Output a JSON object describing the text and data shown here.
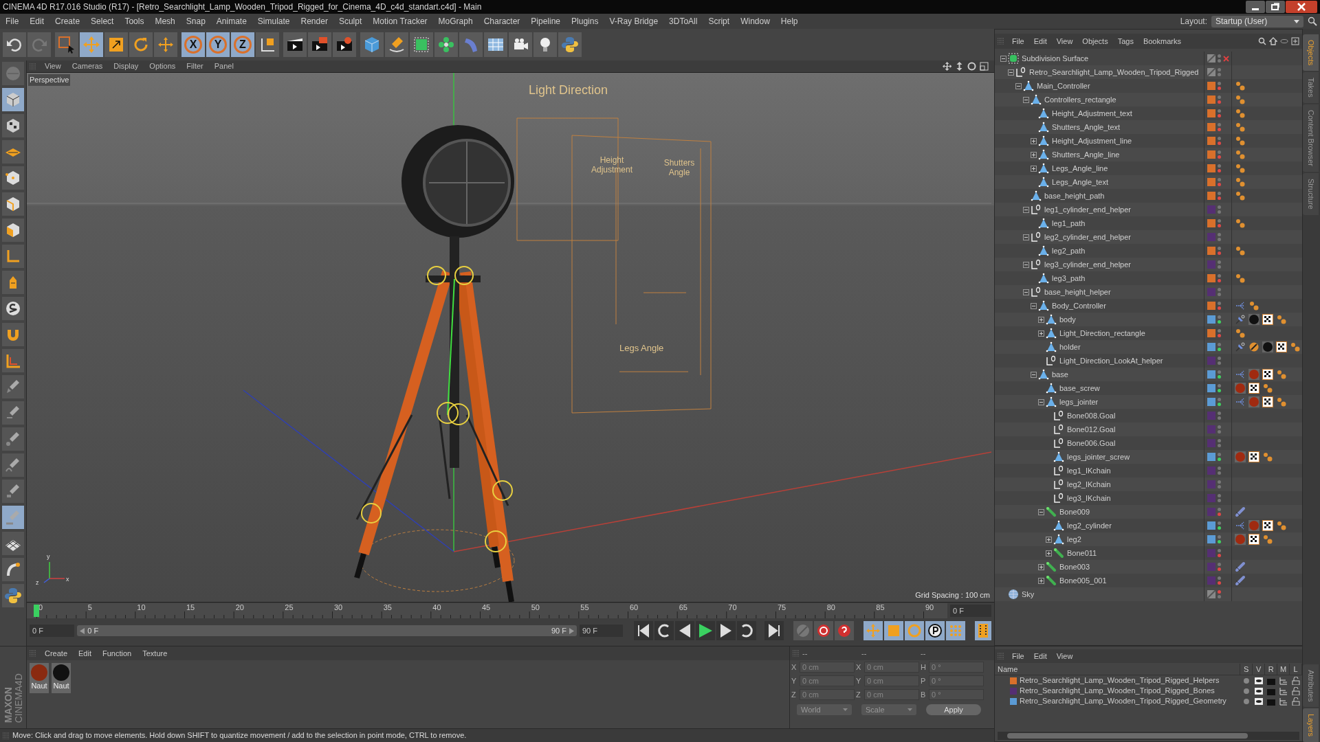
{
  "window": {
    "title": "CINEMA 4D R17.016 Studio (R17) - [Retro_Searchlight_Lamp_Wooden_Tripod_Rigged_for_Cinema_4D_c4d_standart.c4d] - Main"
  },
  "menu": [
    "File",
    "Edit",
    "Create",
    "Select",
    "Tools",
    "Mesh",
    "Snap",
    "Animate",
    "Simulate",
    "Render",
    "Sculpt",
    "Motion Tracker",
    "MoGraph",
    "Character",
    "Pipeline",
    "Plugins",
    "V-Ray Bridge",
    "3DToAll",
    "Script",
    "Window",
    "Help"
  ],
  "layout": {
    "label": "Layout:",
    "value": "Startup (User)"
  },
  "toolbar": {
    "mode_tools": [
      {
        "kind": "select",
        "selected": false
      },
      {
        "kind": "move",
        "selected": true
      },
      {
        "kind": "scale",
        "selected": false
      },
      {
        "kind": "rotate",
        "selected": false
      },
      {
        "kind": "last",
        "selected": false
      }
    ],
    "axes": [
      {
        "label": "X",
        "on": true
      },
      {
        "label": "Y",
        "on": true
      },
      {
        "label": "Z",
        "on": true
      }
    ]
  },
  "viewport": {
    "menu": [
      "View",
      "Cameras",
      "Display",
      "Options",
      "Filter",
      "Panel"
    ],
    "camera": "Perspective",
    "labels": [
      {
        "kind": "title",
        "text": "Light Direction"
      },
      {
        "kind": "height",
        "text": "Height Adjustment"
      },
      {
        "kind": "shutters",
        "text": "Shutters Angle"
      },
      {
        "kind": "legs",
        "text": "Legs Angle"
      }
    ],
    "axis_labels": [
      "y",
      "z",
      "x"
    ],
    "grid_spacing": "Grid Spacing : 100 cm"
  },
  "timeline": {
    "ticks": [
      "0",
      "5",
      "10",
      "15",
      "20",
      "25",
      "30",
      "35",
      "40",
      "45",
      "50",
      "55",
      "60",
      "65",
      "70",
      "75",
      "80",
      "85",
      "90"
    ],
    "level": 0,
    "current_frame": "0 F",
    "start_field": "0 F",
    "range": {
      "start": "0 F",
      "end": "90 F"
    },
    "end_field": "90 F"
  },
  "materials": {
    "menu": [
      "Create",
      "Edit",
      "Function",
      "Texture"
    ],
    "items": [
      {
        "name": "Naut",
        "color": "#8a2a10"
      },
      {
        "name": "Naut",
        "color": "#111111"
      }
    ]
  },
  "logo": [
    "MAXON",
    "CINEMA4D"
  ],
  "coordinates": {
    "disabled": true,
    "headers": [
      "--",
      "--",
      "--"
    ],
    "rows": [
      {
        "axis": "X",
        "value": "0 cm",
        "size_axis": "X",
        "size": "0 cm",
        "rot_axis": "H",
        "rot": "0 °"
      },
      {
        "axis": "Y",
        "value": "0 cm",
        "size_axis": "Y",
        "size": "0 cm",
        "rot_axis": "P",
        "rot": "0 °"
      },
      {
        "axis": "Z",
        "value": "0 cm",
        "size_axis": "Z",
        "size": "0 cm",
        "rot_axis": "B",
        "rot": "0 °"
      }
    ],
    "space": "World",
    "mode": "Scale",
    "apply": "Apply"
  },
  "status_bar": "Move: Click and drag to move elements. Hold down SHIFT to quantize movement / add to the selection in point mode, CTRL to remove.",
  "objects": {
    "menu": [
      "File",
      "Edit",
      "View",
      "Objects",
      "Tags",
      "Bookmarks"
    ],
    "tree": [
      {
        "name": "Subdivision Surface",
        "kind": "generator",
        "expanded": true,
        "enabled": false,
        "children": [
          {
            "name": "Retro_Searchlight_Lamp_Wooden_Tripod_Rigged",
            "kind": "null",
            "expanded": true,
            "children": [
              {
                "name": "Main_Controller",
                "kind": "polygon",
                "color": "#d9702b",
                "expanded": true,
                "render_visible": false,
                "tags": [
                  {
                    "kind": "display"
                  }
                ],
                "children": [
                  {
                    "name": "Controllers_rectangle",
                    "kind": "polygon",
                    "color": "#d9702b",
                    "expanded": true,
                    "render_visible": false,
                    "tags": [
                      {
                        "kind": "display"
                      }
                    ],
                    "children": [
                      {
                        "name": "Height_Adjustment_text",
                        "kind": "polygon",
                        "color": "#d9702b",
                        "render_visible": false,
                        "tags": [
                          {
                            "kind": "display"
                          }
                        ]
                      },
                      {
                        "name": "Shutters_Angle_text",
                        "kind": "polygon",
                        "color": "#d9702b",
                        "render_visible": false,
                        "tags": [
                          {
                            "kind": "display"
                          }
                        ]
                      },
                      {
                        "name": "Height_Adjustment_line",
                        "kind": "polygon",
                        "color": "#d9702b",
                        "expanded": false,
                        "render_visible": false,
                        "tags": [
                          {
                            "kind": "display"
                          }
                        ]
                      },
                      {
                        "name": "Shutters_Angle_line",
                        "kind": "polygon",
                        "color": "#d9702b",
                        "expanded": false,
                        "render_visible": false,
                        "tags": [
                          {
                            "kind": "display"
                          }
                        ]
                      },
                      {
                        "name": "Legs_Angle_line",
                        "kind": "polygon",
                        "color": "#d9702b",
                        "expanded": false,
                        "render_visible": false,
                        "tags": [
                          {
                            "kind": "display"
                          }
                        ]
                      },
                      {
                        "name": "Legs_Angle_text",
                        "kind": "polygon",
                        "color": "#d9702b",
                        "render_visible": false,
                        "tags": [
                          {
                            "kind": "display"
                          }
                        ]
                      }
                    ]
                  },
                  {
                    "name": "base_height_path",
                    "kind": "polygon",
                    "color": "#d9702b",
                    "render_visible": false,
                    "tags": [
                      {
                        "kind": "display"
                      }
                    ]
                  },
                  {
                    "name": "leg1_cylinder_end_helper",
                    "kind": "null",
                    "color": "#552f73",
                    "expanded": true,
                    "children": [
                      {
                        "name": "leg1_path",
                        "kind": "polygon",
                        "color": "#d9702b",
                        "render_visible": false,
                        "tags": [
                          {
                            "kind": "display"
                          }
                        ]
                      }
                    ]
                  },
                  {
                    "name": "leg2_cylinder_end_helper",
                    "kind": "null",
                    "color": "#552f73",
                    "expanded": true,
                    "children": [
                      {
                        "name": "leg2_path",
                        "kind": "polygon",
                        "color": "#d9702b",
                        "render_visible": false,
                        "tags": [
                          {
                            "kind": "display"
                          }
                        ]
                      }
                    ]
                  },
                  {
                    "name": "leg3_cylinder_end_helper",
                    "kind": "null",
                    "color": "#552f73",
                    "expanded": true,
                    "children": [
                      {
                        "name": "leg3_path",
                        "kind": "polygon",
                        "color": "#d9702b",
                        "render_visible": false,
                        "tags": [
                          {
                            "kind": "display"
                          }
                        ]
                      }
                    ]
                  },
                  {
                    "name": "base_height_helper",
                    "kind": "null",
                    "color": "#552f73",
                    "expanded": true,
                    "children": [
                      {
                        "name": "Body_Controller",
                        "kind": "polygon",
                        "color": "#d9702b",
                        "expanded": true,
                        "render_visible": false,
                        "tags": [
                          {
                            "kind": "constraint"
                          },
                          {
                            "kind": "display"
                          }
                        ],
                        "children": [
                          {
                            "name": "body",
                            "kind": "polygon",
                            "color": "#5b9bd5",
                            "expanded": false,
                            "render_visible": true,
                            "tags": [
                              {
                                "kind": "pin"
                              },
                              {
                                "kind": "black"
                              },
                              {
                                "kind": "texture"
                              },
                              {
                                "kind": "display"
                              }
                            ]
                          },
                          {
                            "name": "Light_Direction_rectangle",
                            "kind": "polygon",
                            "color": "#d9702b",
                            "expanded": false,
                            "render_visible": false,
                            "tags": [
                              {
                                "kind": "display"
                              }
                            ]
                          },
                          {
                            "name": "holder",
                            "kind": "polygon",
                            "color": "#5b9bd5",
                            "render_visible": true,
                            "tags": [
                              {
                                "kind": "pin"
                              },
                              {
                                "kind": "prohibit"
                              },
                              {
                                "kind": "black"
                              },
                              {
                                "kind": "texture"
                              },
                              {
                                "kind": "display"
                              }
                            ]
                          },
                          {
                            "name": "Light_Direction_LookAt_helper",
                            "kind": "null",
                            "color": "#552f73"
                          }
                        ]
                      },
                      {
                        "name": "base",
                        "kind": "polygon",
                        "color": "#5b9bd5",
                        "expanded": true,
                        "render_visible": true,
                        "tags": [
                          {
                            "kind": "constraint"
                          },
                          {
                            "kind": "red"
                          },
                          {
                            "kind": "texture"
                          },
                          {
                            "kind": "display"
                          }
                        ],
                        "children": [
                          {
                            "name": "base_screw",
                            "kind": "polygon",
                            "color": "#5b9bd5",
                            "render_visible": true,
                            "tags": [
                              {
                                "kind": "red"
                              },
                              {
                                "kind": "texture"
                              },
                              {
                                "kind": "display"
                              }
                            ]
                          },
                          {
                            "name": "legs_jointer",
                            "kind": "polygon",
                            "color": "#5b9bd5",
                            "expanded": true,
                            "render_visible": true,
                            "tags": [
                              {
                                "kind": "constraint"
                              },
                              {
                                "kind": "red"
                              },
                              {
                                "kind": "texture"
                              },
                              {
                                "kind": "display"
                              }
                            ],
                            "children": [
                              {
                                "name": "Bone008.Goal",
                                "kind": "null",
                                "color": "#552f73"
                              },
                              {
                                "name": "Bone012.Goal",
                                "kind": "null",
                                "color": "#552f73"
                              },
                              {
                                "name": "Bone006.Goal",
                                "kind": "null",
                                "color": "#552f73"
                              },
                              {
                                "name": "legs_jointer_screw",
                                "kind": "polygon",
                                "color": "#5b9bd5",
                                "render_visible": true,
                                "tags": [
                                  {
                                    "kind": "red"
                                  },
                                  {
                                    "kind": "texture"
                                  },
                                  {
                                    "kind": "display"
                                  }
                                ]
                              },
                              {
                                "name": "leg1_IKchain",
                                "kind": "null",
                                "color": "#552f73"
                              },
                              {
                                "name": "leg2_IKchain",
                                "kind": "null",
                                "color": "#552f73"
                              },
                              {
                                "name": "leg3_IKchain",
                                "kind": "null",
                                "color": "#552f73"
                              }
                            ]
                          },
                          {
                            "name": "Bone009",
                            "kind": "bone",
                            "color": "#552f73",
                            "expanded": true,
                            "render_visible": false,
                            "tags": [
                              {
                                "kind": "ik"
                              }
                            ],
                            "children": [
                              {
                                "name": "leg2_cylinder",
                                "kind": "polygon",
                                "color": "#5b9bd5",
                                "render_visible": true,
                                "tags": [
                                  {
                                    "kind": "constraint"
                                  },
                                  {
                                    "kind": "red"
                                  },
                                  {
                                    "kind": "texture"
                                  },
                                  {
                                    "kind": "display"
                                  }
                                ]
                              },
                              {
                                "name": "leg2",
                                "kind": "polygon",
                                "color": "#5b9bd5",
                                "expanded": false,
                                "render_visible": true,
                                "tags": [
                                  {
                                    "kind": "red"
                                  },
                                  {
                                    "kind": "texture"
                                  },
                                  {
                                    "kind": "display"
                                  }
                                ]
                              },
                              {
                                "name": "Bone011",
                                "kind": "bone",
                                "color": "#552f73",
                                "expanded": false,
                                "render_visible": false
                              }
                            ]
                          },
                          {
                            "name": "Bone003",
                            "kind": "bone",
                            "color": "#552f73",
                            "expanded": false,
                            "render_visible": false,
                            "tags": [
                              {
                                "kind": "ik"
                              }
                            ]
                          },
                          {
                            "name": "Bone005_001",
                            "kind": "bone",
                            "color": "#552f73",
                            "expanded": false,
                            "render_visible": false,
                            "tags": [
                              {
                                "kind": "ik"
                              }
                            ]
                          }
                        ]
                      }
                    ]
                  }
                ]
              }
            ]
          }
        ]
      },
      {
        "name": "Sky",
        "kind": "sky",
        "editor_visible": false
      }
    ]
  },
  "layers": {
    "menu": [
      "File",
      "Edit",
      "View"
    ],
    "columns": [
      "Name",
      "S",
      "V",
      "R",
      "M",
      "L"
    ],
    "rows": [
      {
        "name": "Retro_Searchlight_Lamp_Wooden_Tripod_Rigged_Helpers",
        "color": "#d9702b"
      },
      {
        "name": "Retro_Searchlight_Lamp_Wooden_Tripod_Rigged_Bones",
        "color": "#552f73"
      },
      {
        "name": "Retro_Searchlight_Lamp_Wooden_Tripod_Rigged_Geometry",
        "color": "#5b9bd5"
      }
    ]
  },
  "side_tabs_top": [
    {
      "label": "Objects",
      "selected": true
    },
    {
      "label": "Takes",
      "selected": false
    },
    {
      "label": "Content Browser",
      "selected": false
    },
    {
      "label": "Structure",
      "selected": false
    }
  ],
  "side_tabs_bottom": [
    {
      "label": "Attributes",
      "selected": false
    },
    {
      "label": "Layers",
      "selected": true
    }
  ]
}
